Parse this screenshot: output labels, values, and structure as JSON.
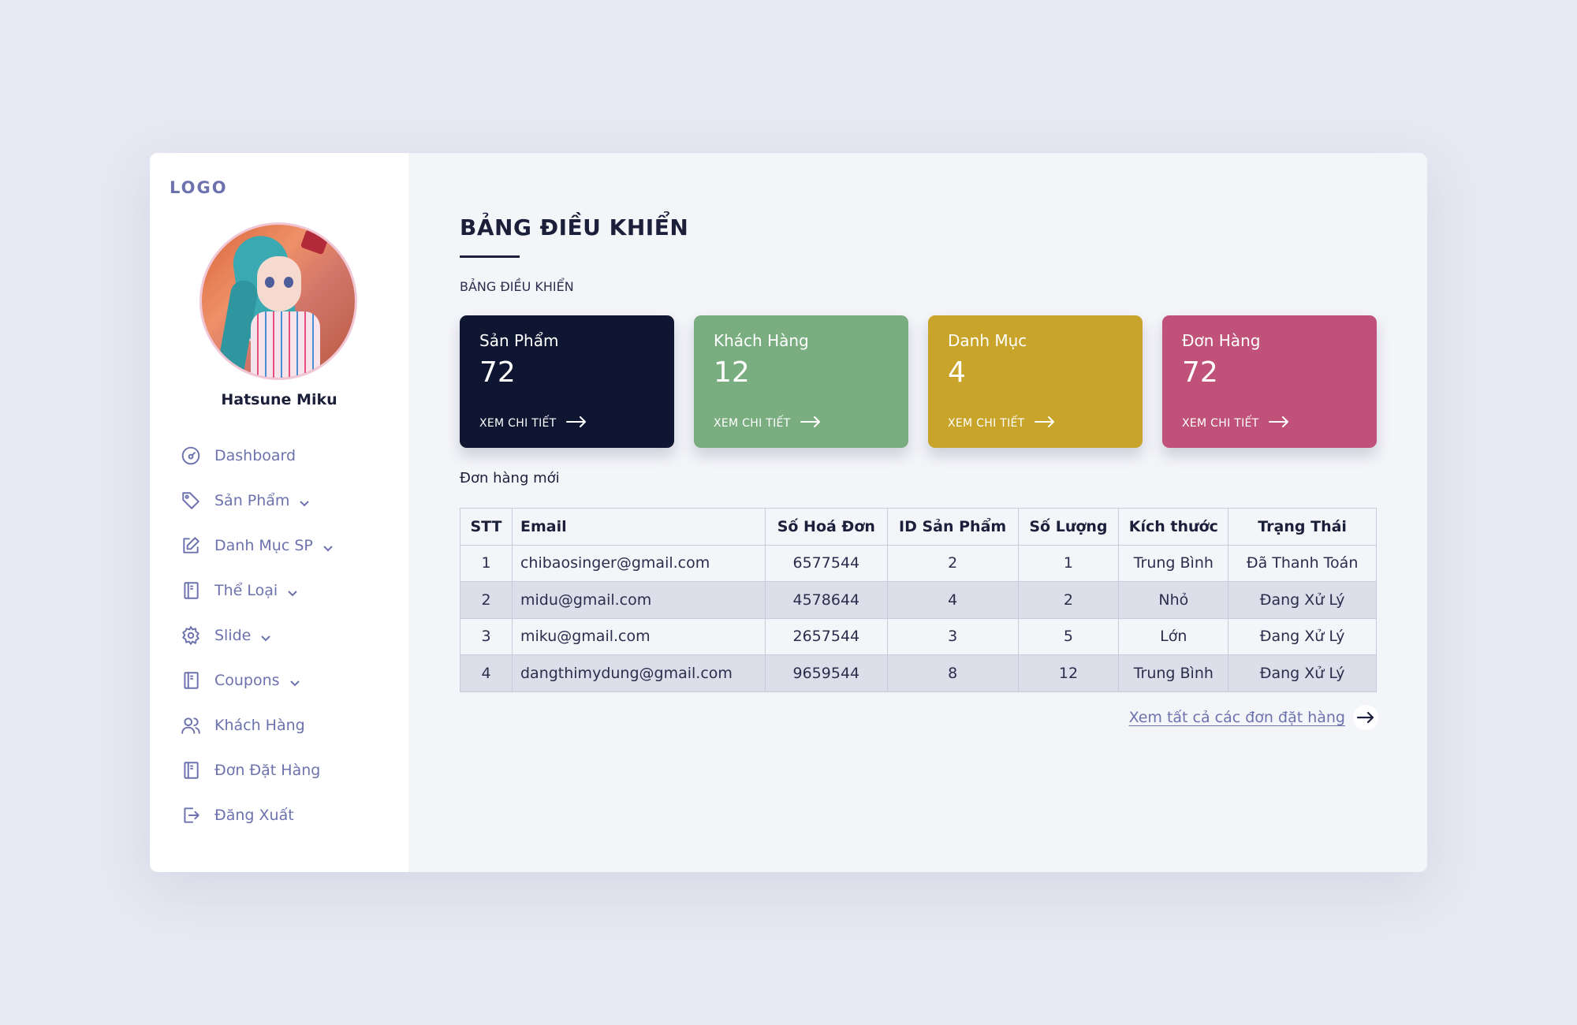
{
  "sidebar": {
    "logo": "LOGO",
    "username": "Hatsune Miku",
    "items": [
      {
        "label": "Dashboard",
        "icon": "dashboard-icon",
        "chevron": false
      },
      {
        "label": "Sản Phẩm",
        "icon": "tag-icon",
        "chevron": true
      },
      {
        "label": "Danh Mục SP",
        "icon": "edit-icon",
        "chevron": true
      },
      {
        "label": "Thể Loại",
        "icon": "book-icon",
        "chevron": true
      },
      {
        "label": "Slide",
        "icon": "gear-icon",
        "chevron": true
      },
      {
        "label": "Coupons",
        "icon": "book-icon",
        "chevron": true
      },
      {
        "label": "Khách Hàng",
        "icon": "users-icon",
        "chevron": false
      },
      {
        "label": "Đơn Đặt Hàng",
        "icon": "book-icon",
        "chevron": false
      },
      {
        "label": "Đăng Xuất",
        "icon": "logout-icon",
        "chevron": false
      }
    ]
  },
  "main": {
    "title": "BẢNG ĐIỀU KHIỂN",
    "breadcrumb": "BẢNG ĐIỀU KHIỂN",
    "cards": [
      {
        "title": "Sản Phẩm",
        "value": "72",
        "link": "XEM CHI TIẾT",
        "color": "#0e1631"
      },
      {
        "title": "Khách Hàng",
        "value": "12",
        "link": "XEM CHI TIẾT",
        "color": "#7aae81"
      },
      {
        "title": "Danh Mục",
        "value": "4",
        "link": "XEM CHI TIẾT",
        "color": "#c9a42a"
      },
      {
        "title": "Đơn Hàng",
        "value": "72",
        "link": "XEM CHI TIẾT",
        "color": "#c0527a"
      }
    ],
    "section_title": "Đơn hàng mới",
    "table": {
      "headers": [
        "STT",
        "Email",
        "Số Hoá Đơn",
        "ID Sản Phẩm",
        "Số Lượng",
        "Kích thước",
        "Trạng Thái"
      ],
      "rows": [
        [
          "1",
          "chibaosinger@gmail.com",
          "6577544",
          "2",
          "1",
          "Trung Bình",
          "Đã Thanh Toán"
        ],
        [
          "2",
          "midu@gmail.com",
          "4578644",
          "4",
          "2",
          "Nhỏ",
          "Đang Xử Lý"
        ],
        [
          "3",
          "miku@gmail.com",
          "2657544",
          "3",
          "5",
          "Lớn",
          "Đang Xử Lý"
        ],
        [
          "4",
          "dangthimydung@gmail.com",
          "9659544",
          "8",
          "12",
          "Trung Bình",
          "Đang Xử Lý"
        ]
      ]
    },
    "view_all": "Xem tất cả các đơn đặt hàng"
  }
}
